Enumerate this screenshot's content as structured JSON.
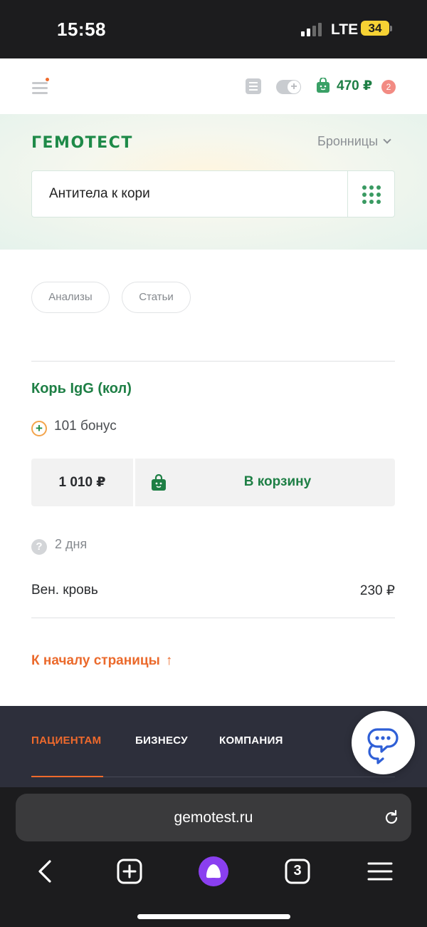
{
  "status_bar": {
    "time": "15:58",
    "network": "LTE",
    "battery": "34"
  },
  "header": {
    "cart_total": "470 ₽",
    "cart_count": "2"
  },
  "hero": {
    "logo": "ГЕМОТЕСТ",
    "city": "Бронницы",
    "search": {
      "value": "Антитела к кори"
    }
  },
  "chips": [
    "Анализы",
    "Статьи"
  ],
  "result": {
    "title": "Корь IgG (кол)",
    "bonus": "101 бонус",
    "price": "1 010 ₽",
    "cart_button": "В корзину",
    "term": "2 дня",
    "biomaterial": {
      "label": "Вен. кровь",
      "price": "230 ₽"
    }
  },
  "to_top": "К началу страницы",
  "footer": {
    "tabs": [
      "ПАЦИЕНТАМ",
      "БИЗНЕСУ",
      "КОМПАНИЯ"
    ]
  },
  "browser": {
    "url": "gemotest.ru",
    "tabs_count": "3"
  },
  "colors": {
    "brand_green": "#1e7f45",
    "accent_orange": "#eb6a2c",
    "footer_bg": "#2d2f3b"
  }
}
